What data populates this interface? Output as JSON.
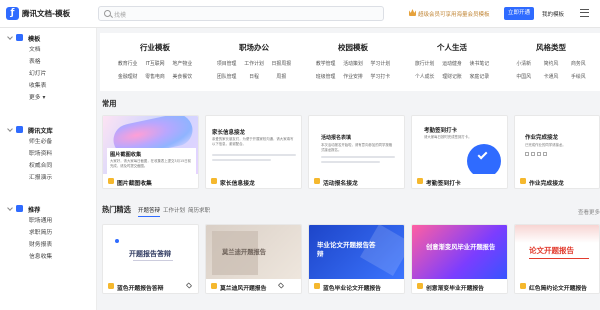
{
  "app": {
    "title": "腾讯文档-模板",
    "logo_char": "ƒ"
  },
  "search": {
    "placeholder": "找模"
  },
  "topbar": {
    "member_promo": "超级会员可享用海量会员模板",
    "open_btn": "立即开通",
    "my_templates": "我的模板"
  },
  "sidebar": {
    "groups": [
      {
        "label": "模板",
        "items": [
          "文档",
          "表格",
          "幻灯片",
          "收集表",
          "更多"
        ]
      },
      {
        "label": "腾讯文库",
        "items": [
          "师生必备",
          "职场资料",
          "权威合同",
          "汇报演示"
        ]
      },
      {
        "label": "推荐",
        "items": [
          "职场通用",
          "求职简历",
          "财务报表",
          "信息收集"
        ]
      }
    ]
  },
  "categories": [
    {
      "title": "行业模板",
      "links": [
        "教育行业",
        "IT互联网",
        "地产物业",
        "金融理财",
        "零售电商",
        "美食餐饮"
      ]
    },
    {
      "title": "职场办公",
      "links": [
        "项目管理",
        "工作计划",
        "日报周报",
        "团队管理",
        "日程",
        "周报"
      ]
    },
    {
      "title": "校园模板",
      "links": [
        "教学管理",
        "活动策划",
        "学习计划",
        "班级管理",
        "作业安排",
        "学习打卡"
      ]
    },
    {
      "title": "个人生活",
      "links": [
        "旅行计划",
        "运动健身",
        "读书笔记",
        "个人成长",
        "理财记账",
        "家庭记录"
      ]
    },
    {
      "title": "风格类型",
      "links": [
        "小清新",
        "简约风",
        "商务风",
        "中国风",
        "卡通风",
        "手绘风"
      ]
    }
  ],
  "sections": {
    "common_title": "常用",
    "featured_title": "热门精选",
    "sub_tabs": [
      "开题答辩",
      "工作计划",
      "简历求职"
    ],
    "more": "查看更多"
  },
  "common_cards": [
    {
      "label": "图片截图收集",
      "thumb_title": "图片截图收集",
      "thumb_body": "大家好，请大家每日截图，在收集表上提交3月15日前完成，请及时提交截图。"
    },
    {
      "label": "家长信息接龙",
      "thumb_title": "家长信息接龙",
      "thumb_body": "亲爱的家长朋友们，为便于开展家校沟通，请大家填写以下信息，谢谢配合。"
    },
    {
      "label": "活动报名接龙",
      "thumb_title": "活动报名表填",
      "thumb_body": "本次活动报名开始啦，请有意向参加的同学按格式接龙报名。"
    },
    {
      "label": "考勤签到打卡",
      "thumb_title": "考勤签到打卡",
      "thumb_body": "请大家每日按时完成签到打卡。"
    },
    {
      "label": "作业完成接龙",
      "thumb_title": "作业完成接龙",
      "thumb_body": "已完成作业的同学请接龙。"
    }
  ],
  "featured_cards": [
    {
      "label": "蓝色开题报告答辩",
      "thumb_text": "开题报告答辩"
    },
    {
      "label": "莫兰迪风开题报告",
      "thumb_text": "莫兰迪开题报告"
    },
    {
      "label": "蓝色毕业论文开题报告",
      "thumb_text": "毕业论文开题报告答辩"
    },
    {
      "label": "创意渐变毕业开题报告",
      "thumb_text": "创意渐变风毕业开题报告"
    },
    {
      "label": "红色简约论文开题报告",
      "thumb_text": "论文开题报告"
    }
  ],
  "colors": {
    "accent": "#2f6bff",
    "promo": "#c2883a",
    "red": "#e23b2e"
  }
}
